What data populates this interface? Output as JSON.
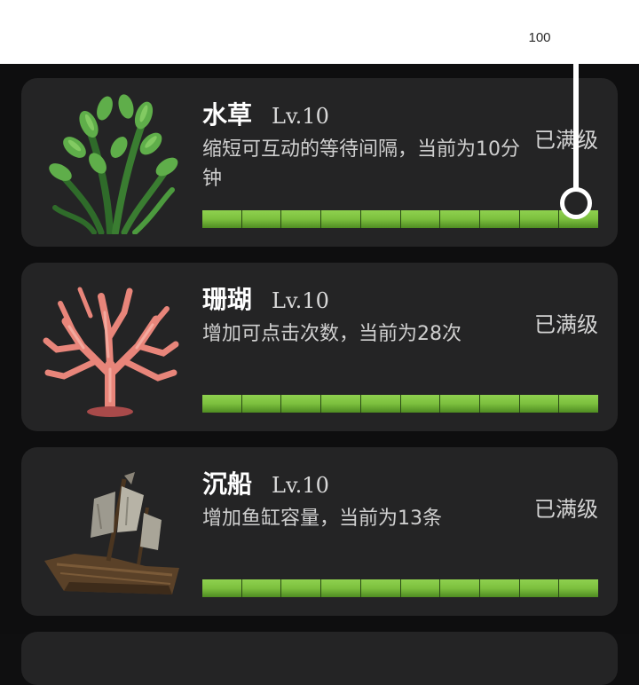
{
  "callout": {
    "label": "100"
  },
  "items": [
    {
      "name": "水草",
      "level": "Lv.10",
      "description": "缩短可互动的等待间隔，当前为10分钟",
      "status": "已满级",
      "progress_segments_filled": 10,
      "progress_segments_total": 10,
      "thumbnail": "aquatic-plant-icon"
    },
    {
      "name": "珊瑚",
      "level": "Lv.10",
      "description": "增加可点击次数，当前为28次",
      "status": "已满级",
      "progress_segments_filled": 10,
      "progress_segments_total": 10,
      "thumbnail": "coral-icon"
    },
    {
      "name": "沉船",
      "level": "Lv.10",
      "description": "增加鱼缸容量，当前为13条",
      "status": "已满级",
      "progress_segments_filled": 10,
      "progress_segments_total": 10,
      "thumbnail": "shipwreck-icon"
    }
  ],
  "colors": {
    "card_bg": "#242425",
    "progress_fill": "#7cc03e",
    "background": "#0e0e0f"
  }
}
